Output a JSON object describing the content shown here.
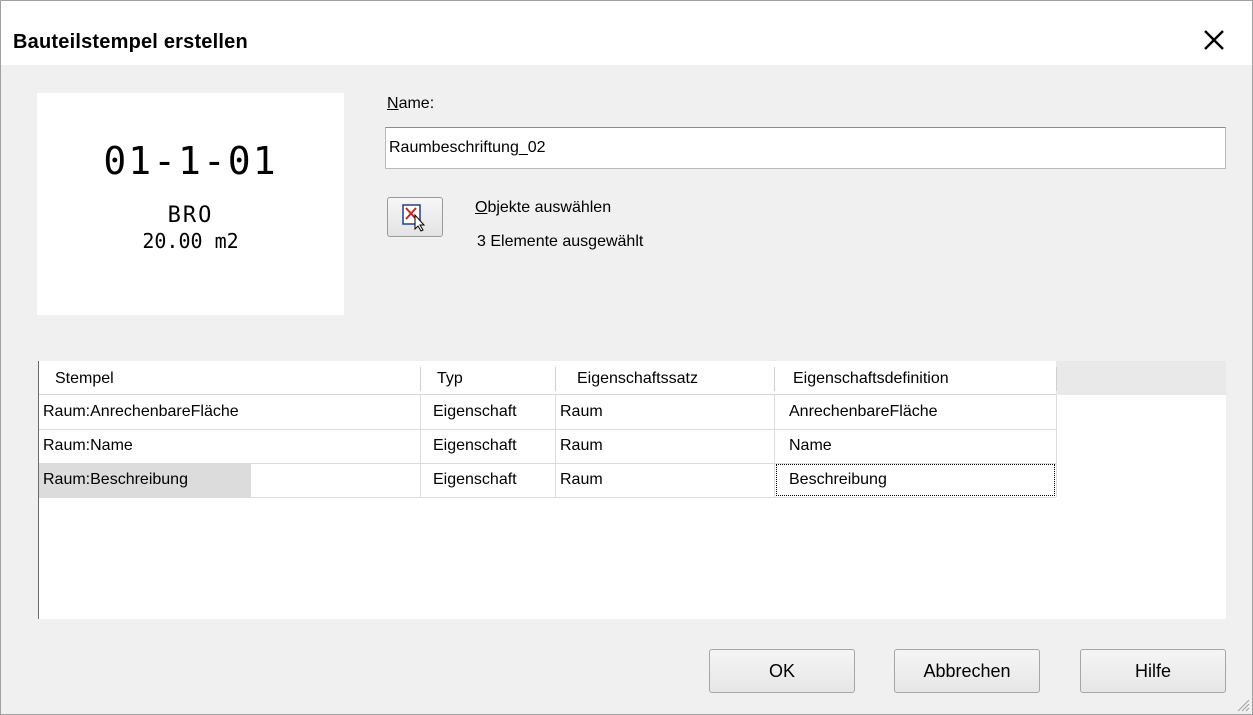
{
  "window": {
    "title": "Bauteilstempel erstellen",
    "close_icon": "close-x-icon"
  },
  "preview": {
    "number": "01-1-01",
    "name": "BRO",
    "area": "20.00 m2"
  },
  "name_field": {
    "label_hotkey": "N",
    "label_rest": "ame:",
    "value": "Raumbeschriftung_02"
  },
  "select_objects": {
    "icon": "select-objects-icon",
    "label_hotkey": "O",
    "label_rest": "bjekte auswählen",
    "count_text": "3 Elemente ausgewählt"
  },
  "table": {
    "columns": [
      "Stempel",
      "Typ",
      "Eigenschaftssatz",
      "Eigenschaftsdefinition"
    ],
    "rows": [
      [
        "Raum:AnrechenbareFläche",
        "Eigenschaft",
        "Raum",
        "AnrechenbareFläche"
      ],
      [
        "Raum:Name",
        "Eigenschaft",
        "Raum",
        "Name"
      ],
      [
        "Raum:Beschreibung",
        "Eigenschaft",
        "Raum",
        "Beschreibung"
      ]
    ],
    "selected_row_index": 2
  },
  "buttons": {
    "ok": "OK",
    "cancel": "Abbrechen",
    "help": "Hilfe"
  },
  "colors": {
    "dialog_bg": "#f0f0f0",
    "selection_bg": "#dcdcdc",
    "header_bg": "#e9e9e9"
  }
}
